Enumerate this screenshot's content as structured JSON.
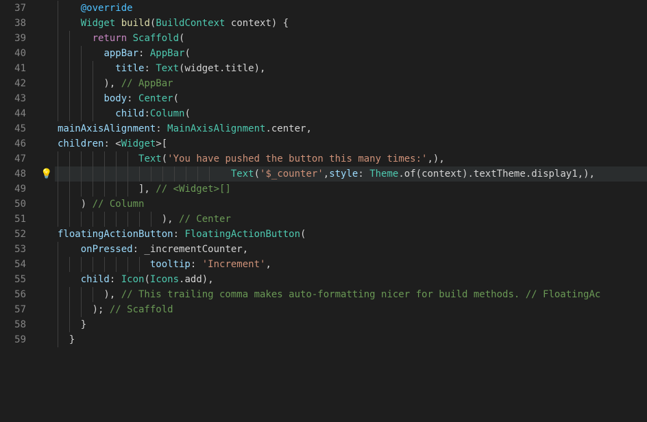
{
  "lines": [
    {
      "num": 37,
      "hl": false,
      "glyph": null,
      "guides": 1,
      "tokens": [
        {
          "cls": "c-plain",
          "t": "    "
        },
        {
          "cls": "c-annotation",
          "t": "@override"
        }
      ]
    },
    {
      "num": 38,
      "hl": false,
      "glyph": null,
      "guides": 1,
      "tokens": [
        {
          "cls": "c-plain",
          "t": "    "
        },
        {
          "cls": "c-type",
          "t": "Widget"
        },
        {
          "cls": "c-plain",
          "t": " "
        },
        {
          "cls": "c-fn",
          "t": "build"
        },
        {
          "cls": "c-punct",
          "t": "("
        },
        {
          "cls": "c-type",
          "t": "BuildContext"
        },
        {
          "cls": "c-plain",
          "t": " context) {"
        }
      ]
    },
    {
      "num": 39,
      "hl": false,
      "glyph": null,
      "guides": 2,
      "tokens": [
        {
          "cls": "c-plain",
          "t": "      "
        },
        {
          "cls": "c-keyword",
          "t": "return"
        },
        {
          "cls": "c-plain",
          "t": " "
        },
        {
          "cls": "c-class",
          "t": "Scaffold"
        },
        {
          "cls": "c-punct",
          "t": "("
        }
      ]
    },
    {
      "num": 40,
      "hl": false,
      "glyph": null,
      "guides": 3,
      "tokens": [
        {
          "cls": "c-plain",
          "t": "        "
        },
        {
          "cls": "c-member",
          "t": "appBar"
        },
        {
          "cls": "c-punct",
          "t": ": "
        },
        {
          "cls": "c-class",
          "t": "AppBar"
        },
        {
          "cls": "c-punct",
          "t": "("
        }
      ]
    },
    {
      "num": 41,
      "hl": false,
      "glyph": null,
      "guides": 4,
      "tokens": [
        {
          "cls": "c-plain",
          "t": "          "
        },
        {
          "cls": "c-member",
          "t": "title"
        },
        {
          "cls": "c-punct",
          "t": ": "
        },
        {
          "cls": "c-class",
          "t": "Text"
        },
        {
          "cls": "c-punct",
          "t": "(widget.title),"
        }
      ]
    },
    {
      "num": 42,
      "hl": false,
      "glyph": null,
      "guides": 4,
      "tokens": [
        {
          "cls": "c-plain",
          "t": "        ), "
        },
        {
          "cls": "c-comment",
          "t": "// AppBar"
        }
      ]
    },
    {
      "num": 43,
      "hl": false,
      "glyph": null,
      "guides": 4,
      "tokens": [
        {
          "cls": "c-plain",
          "t": "        "
        },
        {
          "cls": "c-member",
          "t": "body"
        },
        {
          "cls": "c-punct",
          "t": ": "
        },
        {
          "cls": "c-class",
          "t": "Center"
        },
        {
          "cls": "c-punct",
          "t": "("
        }
      ]
    },
    {
      "num": 44,
      "hl": false,
      "glyph": null,
      "guides": 4,
      "tokens": [
        {
          "cls": "c-plain",
          "t": "          "
        },
        {
          "cls": "c-member",
          "t": "child"
        },
        {
          "cls": "c-punct",
          "t": ":"
        },
        {
          "cls": "c-class",
          "t": "Column"
        },
        {
          "cls": "c-punct",
          "t": "("
        }
      ]
    },
    {
      "num": 45,
      "hl": false,
      "glyph": null,
      "guides": 0,
      "tokens": [
        {
          "cls": "c-member",
          "t": "mainAxisAlignment"
        },
        {
          "cls": "c-punct",
          "t": ": "
        },
        {
          "cls": "c-class",
          "t": "MainAxisAlignment"
        },
        {
          "cls": "c-punct",
          "t": ".center,"
        }
      ]
    },
    {
      "num": 46,
      "hl": false,
      "glyph": null,
      "guides": 0,
      "tokens": [
        {
          "cls": "c-member",
          "t": "children"
        },
        {
          "cls": "c-punct",
          "t": ": <"
        },
        {
          "cls": "c-type",
          "t": "Widget"
        },
        {
          "cls": "c-punct",
          "t": ">["
        }
      ]
    },
    {
      "num": 47,
      "hl": false,
      "glyph": null,
      "guides": 7,
      "tokens": [
        {
          "cls": "c-plain",
          "t": "              "
        },
        {
          "cls": "c-class",
          "t": "Text"
        },
        {
          "cls": "c-punct",
          "t": "("
        },
        {
          "cls": "c-string",
          "t": "'You have pushed the button this many times:'"
        },
        {
          "cls": "c-punct",
          "t": ",),"
        }
      ]
    },
    {
      "num": 48,
      "hl": true,
      "glyph": "bulb",
      "guides": 14,
      "tokens": [
        {
          "cls": "c-plain",
          "t": "                              "
        },
        {
          "cls": "c-class",
          "t": "Text"
        },
        {
          "cls": "c-punct",
          "t": "("
        },
        {
          "cls": "c-string",
          "t": "'$_counter'"
        },
        {
          "cls": "c-punct",
          "t": ","
        },
        {
          "cls": "c-member",
          "t": "style"
        },
        {
          "cls": "c-punct",
          "t": ": "
        },
        {
          "cls": "c-class",
          "t": "Theme"
        },
        {
          "cls": "c-punct",
          "t": ".of(context).textTheme.display1,),"
        }
      ]
    },
    {
      "num": 49,
      "hl": false,
      "glyph": null,
      "guides": 7,
      "tokens": [
        {
          "cls": "c-plain",
          "t": "              ], "
        },
        {
          "cls": "c-comment",
          "t": "// <Widget>[]"
        }
      ]
    },
    {
      "num": 50,
      "hl": false,
      "glyph": null,
      "guides": 2,
      "tokens": [
        {
          "cls": "c-plain",
          "t": "    ) "
        },
        {
          "cls": "c-comment",
          "t": "// Column"
        }
      ]
    },
    {
      "num": 51,
      "hl": false,
      "glyph": null,
      "guides": 9,
      "tokens": [
        {
          "cls": "c-plain",
          "t": "                  ), "
        },
        {
          "cls": "c-comment",
          "t": "// Center"
        }
      ]
    },
    {
      "num": 52,
      "hl": false,
      "glyph": null,
      "guides": 0,
      "tokens": [
        {
          "cls": "c-member",
          "t": "floatingActionButton"
        },
        {
          "cls": "c-punct",
          "t": ": "
        },
        {
          "cls": "c-class",
          "t": "FloatingActionButton"
        },
        {
          "cls": "c-punct",
          "t": "("
        }
      ]
    },
    {
      "num": 53,
      "hl": false,
      "glyph": null,
      "guides": 1,
      "tokens": [
        {
          "cls": "c-plain",
          "t": "    "
        },
        {
          "cls": "c-member",
          "t": "onPressed"
        },
        {
          "cls": "c-punct",
          "t": ": _incrementCounter,"
        }
      ]
    },
    {
      "num": 54,
      "hl": false,
      "glyph": null,
      "guides": 8,
      "tokens": [
        {
          "cls": "c-plain",
          "t": "                "
        },
        {
          "cls": "c-member",
          "t": "tooltip"
        },
        {
          "cls": "c-punct",
          "t": ": "
        },
        {
          "cls": "c-string",
          "t": "'Increment'"
        },
        {
          "cls": "c-punct",
          "t": ","
        }
      ]
    },
    {
      "num": 55,
      "hl": false,
      "glyph": null,
      "guides": 1,
      "tokens": [
        {
          "cls": "c-plain",
          "t": "    "
        },
        {
          "cls": "c-member",
          "t": "child"
        },
        {
          "cls": "c-punct",
          "t": ": "
        },
        {
          "cls": "c-class",
          "t": "Icon"
        },
        {
          "cls": "c-punct",
          "t": "("
        },
        {
          "cls": "c-class",
          "t": "Icons"
        },
        {
          "cls": "c-punct",
          "t": ".add),"
        }
      ]
    },
    {
      "num": 56,
      "hl": false,
      "glyph": null,
      "guides": 4,
      "tokens": [
        {
          "cls": "c-plain",
          "t": "        ), "
        },
        {
          "cls": "c-comment",
          "t": "// This trailing comma makes auto-formatting nicer for build methods. // FloatingAc"
        }
      ]
    },
    {
      "num": 57,
      "hl": false,
      "glyph": null,
      "guides": 3,
      "tokens": [
        {
          "cls": "c-plain",
          "t": "      ); "
        },
        {
          "cls": "c-comment",
          "t": "// Scaffold"
        }
      ]
    },
    {
      "num": 58,
      "hl": false,
      "glyph": null,
      "guides": 2,
      "tokens": [
        {
          "cls": "c-plain",
          "t": "    }"
        }
      ]
    },
    {
      "num": 59,
      "hl": false,
      "glyph": null,
      "guides": 1,
      "tokens": [
        {
          "cls": "c-plain",
          "t": "  }"
        }
      ]
    }
  ]
}
